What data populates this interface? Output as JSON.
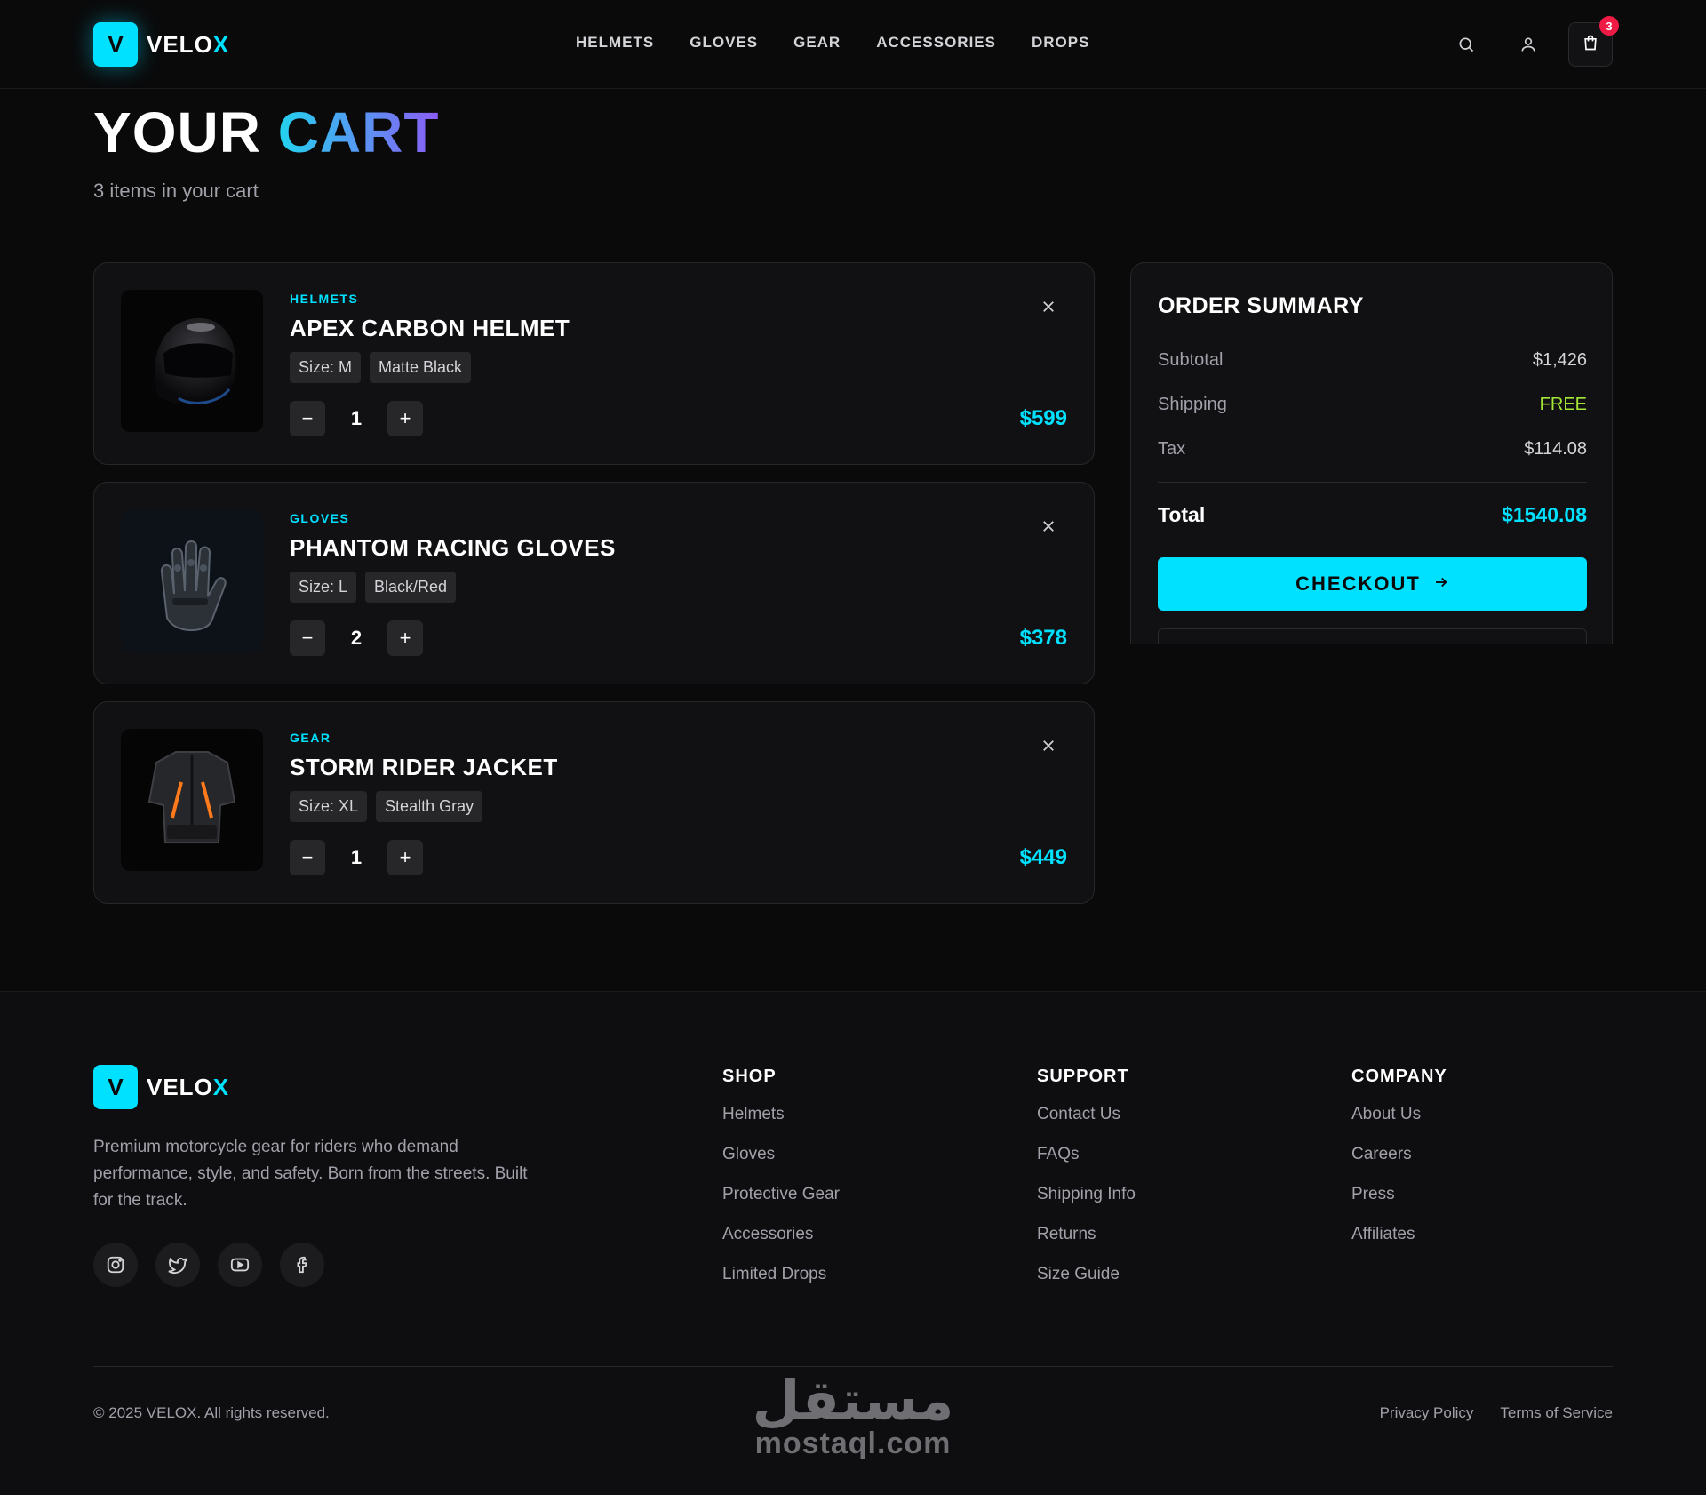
{
  "brand": {
    "letter": "V",
    "name_main": "VELO",
    "name_accent": "X"
  },
  "nav": [
    "HELMETS",
    "GLOVES",
    "GEAR",
    "ACCESSORIES",
    "DROPS"
  ],
  "header": {
    "cart_count": "3",
    "search_icon": "search-icon",
    "user_icon": "user-icon",
    "cart_icon": "shopping-bag-icon"
  },
  "page": {
    "title_main": "YOUR",
    "title_accent": "CART",
    "subtitle": "3 items in your cart"
  },
  "cart_items": [
    {
      "category": "HELMETS",
      "name": "APEX CARBON HELMET",
      "size": "Size: M",
      "color": "Matte Black",
      "qty": "1",
      "price": "$599",
      "qty_minus": "−",
      "qty_plus": "+"
    },
    {
      "category": "GLOVES",
      "name": "PHANTOM RACING GLOVES",
      "size": "Size: L",
      "color": "Black/Red",
      "qty": "2",
      "price": "$378",
      "qty_minus": "−",
      "qty_plus": "+"
    },
    {
      "category": "GEAR",
      "name": "STORM RIDER JACKET",
      "size": "Size: XL",
      "color": "Stealth Gray",
      "qty": "1",
      "price": "$449",
      "qty_minus": "−",
      "qty_plus": "+"
    }
  ],
  "summary": {
    "title": "ORDER SUMMARY",
    "subtotal_label": "Subtotal",
    "subtotal_value": "$1,426",
    "shipping_label": "Shipping",
    "shipping_value": "FREE",
    "tax_label": "Tax",
    "tax_value": "$114.08",
    "total_label": "Total",
    "total_value": "$1540.08",
    "checkout_label": "CHECKOUT"
  },
  "footer": {
    "description": "Premium motorcycle gear for riders who demand performance, style, and safety. Born from the streets. Built for the track.",
    "socials": [
      "instagram-icon",
      "twitter-icon",
      "youtube-icon",
      "facebook-icon"
    ],
    "columns": [
      {
        "title": "SHOP",
        "links": [
          "Helmets",
          "Gloves",
          "Protective Gear",
          "Accessories",
          "Limited Drops"
        ]
      },
      {
        "title": "SUPPORT",
        "links": [
          "Contact Us",
          "FAQs",
          "Shipping Info",
          "Returns",
          "Size Guide"
        ]
      },
      {
        "title": "COMPANY",
        "links": [
          "About Us",
          "Careers",
          "Press",
          "Affiliates"
        ]
      }
    ],
    "copyright": "© 2025 VELOX. All rights reserved.",
    "legal": [
      "Privacy Policy",
      "Terms of Service"
    ]
  },
  "watermark": {
    "arabic": "مستقل",
    "latin": "mostaql.com"
  },
  "colors": {
    "accent": "#00e1ff",
    "free": "#a3e635",
    "badge": "#ef1b45",
    "background": "#0a0a0b"
  }
}
